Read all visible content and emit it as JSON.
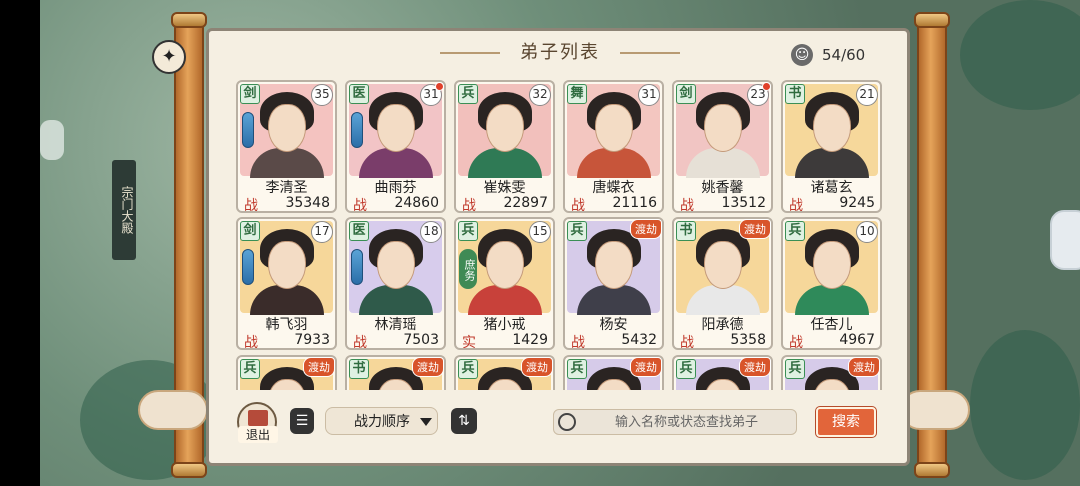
{
  "header": {
    "title": "弟子列表",
    "count": "54/60",
    "count_icon": "person-circle-icon"
  },
  "side": {
    "tag": "宗门大殿"
  },
  "cards": [
    {
      "type": "剑",
      "level": "35",
      "name": "李清圣",
      "stat_label": "战",
      "stat_value": "35348",
      "red_dot": false,
      "dujie": "",
      "duty": "",
      "bg": "#f4c3c0",
      "robe": "#5a4a48"
    },
    {
      "type": "医",
      "level": "31",
      "name": "曲雨芬",
      "stat_label": "战",
      "stat_value": "24860",
      "red_dot": true,
      "dujie": "",
      "duty": "",
      "bg": "#f2c4c6",
      "robe": "#7a3d6a"
    },
    {
      "type": "兵",
      "level": "32",
      "name": "崔姝雯",
      "stat_label": "战",
      "stat_value": "22897",
      "red_dot": false,
      "dujie": "",
      "duty": "",
      "bg": "#f2c0bc",
      "robe": "#2f7a55"
    },
    {
      "type": "舞",
      "level": "31",
      "name": "唐蝶衣",
      "stat_label": "战",
      "stat_value": "21116",
      "red_dot": false,
      "dujie": "",
      "duty": "",
      "bg": "#f3c6c0",
      "robe": "#c7553a"
    },
    {
      "type": "剑",
      "level": "23",
      "name": "姚香馨",
      "stat_label": "战",
      "stat_value": "13512",
      "red_dot": true,
      "dujie": "",
      "duty": "",
      "bg": "#f1c5c3",
      "robe": "#e6e0d6"
    },
    {
      "type": "书",
      "level": "21",
      "name": "诸葛玄",
      "stat_label": "战",
      "stat_value": "9245",
      "red_dot": false,
      "dujie": "",
      "duty": "",
      "bg": "#f6d89b",
      "robe": "#3d3a3a"
    },
    {
      "type": "剑",
      "level": "17",
      "name": "韩飞羽",
      "stat_label": "战",
      "stat_value": "7933",
      "red_dot": false,
      "dujie": "",
      "duty": "",
      "bg": "#f6d79a",
      "robe": "#3a2c2a"
    },
    {
      "type": "医",
      "level": "18",
      "name": "林清瑶",
      "stat_label": "战",
      "stat_value": "7503",
      "red_dot": false,
      "dujie": "",
      "duty": "",
      "bg": "#d7ccec",
      "robe": "#2f5a4a"
    },
    {
      "type": "兵",
      "level": "15",
      "name": "猪小戒",
      "stat_label": "实",
      "stat_value": "1429",
      "red_dot": false,
      "dujie": "",
      "duty": "庶务",
      "bg": "#f6d79a",
      "robe": "#c8413a"
    },
    {
      "type": "兵",
      "level": "",
      "name": "杨安",
      "stat_label": "战",
      "stat_value": "5432",
      "red_dot": false,
      "dujie": "渡劫",
      "duty": "",
      "bg": "#d6cbe9",
      "robe": "#3f3f4a"
    },
    {
      "type": "书",
      "level": "",
      "name": "阳承德",
      "stat_label": "战",
      "stat_value": "5358",
      "red_dot": false,
      "dujie": "渡劫",
      "duty": "",
      "bg": "#f6d79a",
      "robe": "#e8e8e8"
    },
    {
      "type": "兵",
      "level": "10",
      "name": "任杏儿",
      "stat_label": "战",
      "stat_value": "4967",
      "red_dot": false,
      "dujie": "",
      "duty": "",
      "bg": "#f6d79a",
      "robe": "#2f8a5a"
    },
    {
      "type": "兵",
      "level": "",
      "name": "",
      "stat_label": "",
      "stat_value": "",
      "red_dot": false,
      "dujie": "渡劫",
      "duty": "",
      "bg": "#f6d79a",
      "robe": "#333"
    },
    {
      "type": "书",
      "level": "",
      "name": "",
      "stat_label": "",
      "stat_value": "",
      "red_dot": false,
      "dujie": "渡劫",
      "duty": "",
      "bg": "#f6d79a",
      "robe": "#333"
    },
    {
      "type": "兵",
      "level": "",
      "name": "",
      "stat_label": "",
      "stat_value": "",
      "red_dot": false,
      "dujie": "渡劫",
      "duty": "",
      "bg": "#f6d79a",
      "robe": "#333"
    },
    {
      "type": "兵",
      "level": "",
      "name": "",
      "stat_label": "",
      "stat_value": "",
      "red_dot": false,
      "dujie": "渡劫",
      "duty": "",
      "bg": "#d6cbe9",
      "robe": "#333"
    },
    {
      "type": "兵",
      "level": "",
      "name": "",
      "stat_label": "",
      "stat_value": "",
      "red_dot": false,
      "dujie": "渡劫",
      "duty": "",
      "bg": "#d6cbe9",
      "robe": "#333"
    },
    {
      "type": "兵",
      "level": "",
      "name": "",
      "stat_label": "",
      "stat_value": "",
      "red_dot": false,
      "dujie": "渡劫",
      "duty": "",
      "bg": "#d6cbe9",
      "robe": "#333"
    }
  ],
  "toolbar": {
    "exit_label": "退出",
    "exit_icon": "book-icon",
    "list_icon": "list-icon",
    "sort_label": "战力顺序",
    "swap_icon": "swap-arrows-icon",
    "search_placeholder": "输入名称或状态查找弟子",
    "search_value": "",
    "search_button": "搜索"
  },
  "colors": {
    "accent": "#e2653a",
    "paper": "#f5efe2",
    "stat_label": "#c0392b",
    "type_badge": "#3a8f55"
  }
}
